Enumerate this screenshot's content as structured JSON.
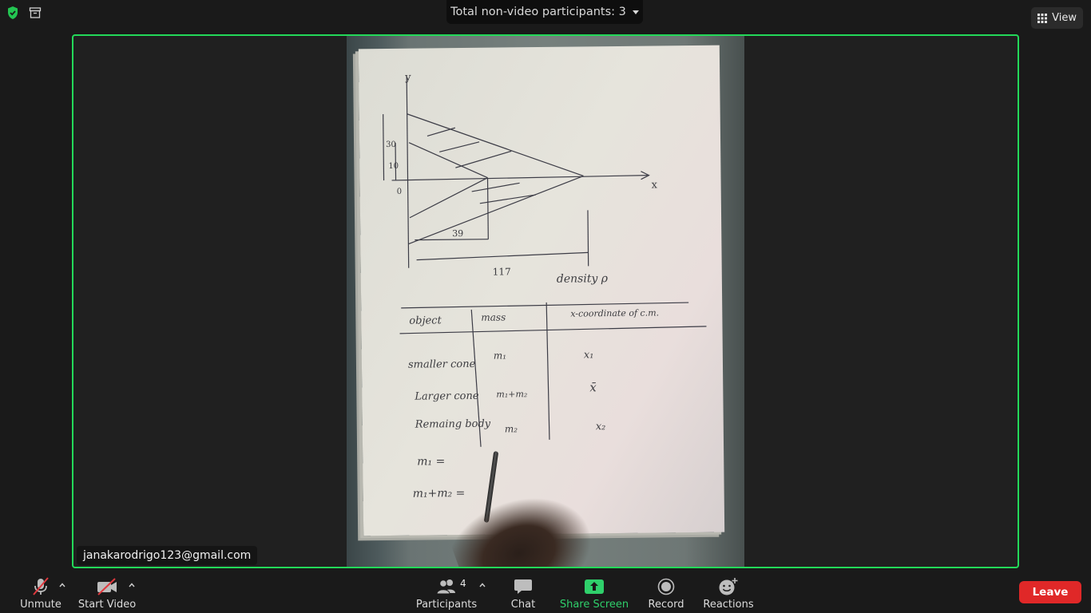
{
  "top": {
    "security_icon": "shield-check-icon",
    "archive_icon": "archive-icon",
    "participants_banner": "Total non-video participants: 3",
    "view_label": "View"
  },
  "video": {
    "name_tag": "janakarodrigo123@gmail.com",
    "border_color": "#23d959",
    "sketch": {
      "axis_y": "y",
      "axis_x": "x",
      "label_30": "30",
      "label_10": "10",
      "label_0": "0",
      "label_39": "39",
      "label_117": "117",
      "density": "density ρ",
      "table_headers": [
        "object",
        "mass",
        "x-coordinate of c.m."
      ],
      "table_rows": [
        [
          "smaller cone",
          "m₁",
          "x₁"
        ],
        [
          "Larger cone",
          "m₁+m₂",
          "x̄"
        ],
        [
          "Remaing body",
          "m₂",
          "x₂"
        ]
      ],
      "eq1": "m₁ =",
      "eq2": "m₁+m₂ ="
    }
  },
  "toolbar": {
    "unmute": "Unmute",
    "start_video": "Start Video",
    "participants": "Participants",
    "participants_count": "4",
    "chat": "Chat",
    "share_screen": "Share Screen",
    "record": "Record",
    "reactions": "Reactions",
    "leave": "Leave",
    "leave_color": "#e02828",
    "share_color": "#2fd06b"
  }
}
